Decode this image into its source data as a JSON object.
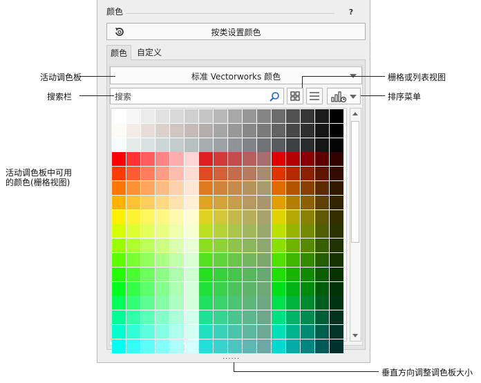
{
  "panel": {
    "title": "颜色",
    "help": "?",
    "set_button": "按类设置颜色",
    "tabs": [
      {
        "label": "颜色"
      },
      {
        "label": "自定义"
      }
    ],
    "palette_dropdown": "标准 Vectorworks 颜色",
    "search_placeholder": "搜索",
    "grip": "......"
  },
  "callouts": {
    "active_palette": "活动调色板",
    "search_bar": "搜索栏",
    "grid_or_list": "栅格或列表视图",
    "sort_menu": "排序菜单",
    "available_colors_1": "活动调色板中可用",
    "available_colors_2": "的颜色(栅格视图)",
    "resize": "垂直方向调整调色板大小"
  },
  "colors": {
    "accent_icon": "#1a66cc",
    "callout_line": "#222222"
  },
  "icons": {
    "set": "refresh-arrow-icon",
    "search": "magnifier-icon",
    "grid": "grid-view-icon",
    "list": "list-view-icon",
    "sort": "sort-icon"
  },
  "swatch_rows": [
    [
      "#ffffff",
      "#f5f5f5",
      "#ebebeb",
      "#e2e2e2",
      "#d8d8d8",
      "#cfcfcf",
      "#c5c5c5",
      "#b8b8b8",
      "#a8a8a8",
      "#979797",
      "#858585",
      "#6c6c6c",
      "#525252",
      "#363636",
      "#1c1c1c",
      "#000000"
    ],
    [
      "#fdfbf6",
      "#f2ebe6",
      "#e6dcd8",
      "#dad0cc",
      "#cfc5c1",
      "#c4bbb8",
      "#b3adab",
      "#a6a6a6",
      "#989898",
      "#888888",
      "#7a7a7a",
      "#636363",
      "#474747",
      "#2f2f2f",
      "#161616",
      "#000000"
    ],
    [
      "#f6fcfb",
      "#e4ecea",
      "#d8e2e0",
      "#ccd6d5",
      "#c0cbca",
      "#b5c0bf",
      "#a5acae",
      "#9ea1a5",
      "#8f9296",
      "#808387",
      "#707275",
      "#5a5b5e",
      "#3f4042",
      "#2a2b2c",
      "#151515",
      "#030303"
    ],
    [
      "#ff0000",
      "#ff3232",
      "#ff5c5c",
      "#ff8484",
      "#ffadad",
      "#ffd4d4",
      "#e02020",
      "#d23a3a",
      "#c44c4c",
      "#b65d5d",
      "#a86e6e",
      "#e00000",
      "#b40000",
      "#8a0000",
      "#5e0000",
      "#330000"
    ],
    [
      "#ff3b00",
      "#ff5c32",
      "#ff7c5c",
      "#ff9c84",
      "#ffbdad",
      "#ffdbd4",
      "#e04a20",
      "#d25e3a",
      "#c46d4c",
      "#b67b5d",
      "#a88a6e",
      "#e03400",
      "#b42900",
      "#8a2000",
      "#5e1500",
      "#330b00"
    ],
    [
      "#ff7700",
      "#ff9232",
      "#ffa55c",
      "#ffbb84",
      "#ffd0ad",
      "#ffe6d4",
      "#e07a20",
      "#d2833a",
      "#c48b4c",
      "#b6935d",
      "#a8996e",
      "#e06900",
      "#b45400",
      "#8a4000",
      "#5e2b00",
      "#331800"
    ],
    [
      "#ffb300",
      "#ffc232",
      "#ffcd5c",
      "#ffd884",
      "#ffe3ad",
      "#ffefd4",
      "#e0a520",
      "#d2a33a",
      "#c49e4c",
      "#b69a5d",
      "#a8976e",
      "#e09e00",
      "#b47e00",
      "#8a6000",
      "#5e4100",
      "#332400"
    ],
    [
      "#ffef00",
      "#fff232",
      "#fff45c",
      "#fff684",
      "#fff8ad",
      "#fffbd4",
      "#e0d220",
      "#d2c53a",
      "#c4b94c",
      "#b6ad5d",
      "#a8a26e",
      "#e0d300",
      "#b4a900",
      "#8a8100",
      "#5e5800",
      "#333000"
    ],
    [
      "#d5ff00",
      "#ddff32",
      "#e3ff5c",
      "#e9ff84",
      "#efffad",
      "#f5ffd4",
      "#bce020",
      "#b6d23a",
      "#abc44c",
      "#a1b65d",
      "#98a86e",
      "#bce000",
      "#96b400",
      "#738a00",
      "#4e5e00",
      "#2b3300"
    ],
    [
      "#99ff00",
      "#adff32",
      "#bdff5c",
      "#cbff84",
      "#daffad",
      "#e9ffd4",
      "#8ae020",
      "#8cd23a",
      "#8cc44c",
      "#8cb65d",
      "#8ca86e",
      "#87e000",
      "#6cb400",
      "#538a00",
      "#385e00",
      "#1f3300"
    ],
    [
      "#5dff00",
      "#7aff32",
      "#93ff5c",
      "#aaff84",
      "#c2ffad",
      "#daffd4",
      "#55e020",
      "#60d23a",
      "#6cc44c",
      "#74b65d",
      "#7ca86e",
      "#52e000",
      "#42b400",
      "#328a00",
      "#225e00",
      "#133300"
    ],
    [
      "#21ff00",
      "#48ff32",
      "#6bff5c",
      "#8cff84",
      "#aeffad",
      "#d0ffd4",
      "#22e020",
      "#35d23a",
      "#47c44c",
      "#58b65d",
      "#69a86e",
      "#1de000",
      "#17b400",
      "#128a00",
      "#0c5e00",
      "#073300"
    ],
    [
      "#00ff1b",
      "#32ff45",
      "#5cff6a",
      "#84ff8e",
      "#adffb4",
      "#d4ffd9",
      "#20e03a",
      "#3ad24d",
      "#4cc45b",
      "#5db668",
      "#6ea876",
      "#00e018",
      "#00b413",
      "#008a0e",
      "#005e0a",
      "#003305"
    ],
    [
      "#00ff57",
      "#32ff75",
      "#5cff8f",
      "#84ffa7",
      "#adffc1",
      "#d4ffdb",
      "#20e060",
      "#3ad26a",
      "#4cc473",
      "#5db67b",
      "#6ea882",
      "#00e04c",
      "#00b43d",
      "#008a2f",
      "#005e20",
      "#003311"
    ],
    [
      "#00ff93",
      "#32ffa8",
      "#5cffb8",
      "#84ffc9",
      "#adffda",
      "#d4ffeb",
      "#20e093",
      "#3ad290",
      "#4cc48d",
      "#5db68c",
      "#6ea88a",
      "#00e081",
      "#00b467",
      "#008a50",
      "#005e36",
      "#00331d"
    ],
    [
      "#00ffcf",
      "#32ffd6",
      "#5cffdd",
      "#84ffe4",
      "#adffec",
      "#d4fff5",
      "#20e0c2",
      "#3ad2b7",
      "#4cc4ab",
      "#5db6a0",
      "#6ea897",
      "#00e0b6",
      "#00b492",
      "#008a70",
      "#005e4c",
      "#003329"
    ],
    [
      "#00fff4",
      "#32fff6",
      "#5cfff7",
      "#84fff9",
      "#adfffa",
      "#d4fffc",
      "#20e0d8",
      "#3ad2cc",
      "#4cc4bf",
      "#5db6b2",
      "#6ea8a6",
      "#00d8d0",
      "#00aca6",
      "#008580",
      "#005b57",
      "#00302e"
    ]
  ]
}
